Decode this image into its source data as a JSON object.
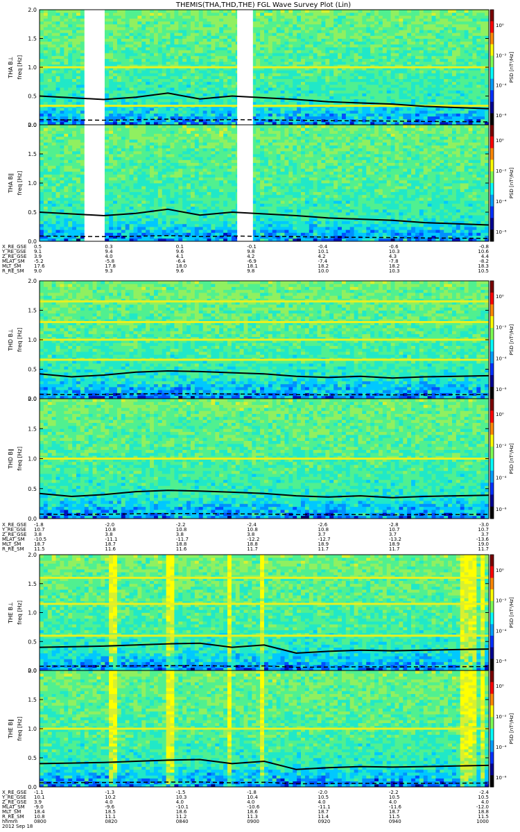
{
  "title": "THEMIS(THA,THD,THE) FGL Wave Survey Plot (Lin)",
  "colorbar": {
    "label": "PSD [nT²/Hz]",
    "ticks": [
      "10⁰",
      "10⁻²",
      "10⁻⁴",
      "10⁻⁶"
    ],
    "colors": [
      "#7a0000",
      "#ff0000",
      "#ff8800",
      "#ffff00",
      "#7fff55",
      "#00ffff",
      "#00a0ff",
      "#0030ff",
      "#000090",
      "#000000"
    ]
  },
  "chart_data": [
    {
      "type": "heatmap",
      "probe": "THA",
      "panel_label": "THA B⊥",
      "ylabel": "freq [Hz]",
      "ylim": [
        0,
        2.0
      ],
      "yticks": [
        "0.0",
        "0.5",
        "1.0",
        "1.5",
        "2.0"
      ],
      "data_gaps_fraction": [
        [
          0.1,
          0.145
        ],
        [
          0.44,
          0.475
        ]
      ],
      "harmonic_lines_hz": [
        1.0,
        0.33
      ],
      "gyro_curve_hz": [
        0.5,
        0.47,
        0.44,
        0.48,
        0.55,
        0.45,
        0.5,
        0.47,
        0.44,
        0.4,
        0.38,
        0.36,
        0.32,
        0.3,
        0.28
      ]
    },
    {
      "type": "heatmap",
      "probe": "THA",
      "panel_label": "THA B∥",
      "ylabel": "freq [Hz]",
      "ylim": [
        0,
        2.0
      ],
      "yticks": [
        "0.0",
        "0.5",
        "1.0",
        "1.5",
        "2.0"
      ],
      "data_gaps_fraction": [
        [
          0.1,
          0.145
        ],
        [
          0.44,
          0.475
        ]
      ],
      "harmonic_lines_hz": [],
      "gyro_curve_hz": [
        0.5,
        0.47,
        0.44,
        0.48,
        0.55,
        0.45,
        0.5,
        0.47,
        0.44,
        0.4,
        0.38,
        0.36,
        0.32,
        0.3,
        0.28
      ]
    },
    {
      "type": "heatmap",
      "probe": "THD",
      "panel_label": "THD B⊥",
      "ylabel": "freq [Hz]",
      "ylim": [
        0,
        2.0
      ],
      "yticks": [
        "0.0",
        "0.5",
        "1.0",
        "1.5",
        "2.0"
      ],
      "data_gaps_fraction": [],
      "harmonic_lines_hz": [
        1.65,
        1.3,
        1.0,
        0.66
      ],
      "gyro_curve_hz": [
        0.42,
        0.37,
        0.4,
        0.45,
        0.47,
        0.46,
        0.44,
        0.42,
        0.38,
        0.36,
        0.38,
        0.35,
        0.37,
        0.38,
        0.39
      ]
    },
    {
      "type": "heatmap",
      "probe": "THD",
      "panel_label": "THD B∥",
      "ylabel": "freq [Hz]",
      "ylim": [
        0,
        2.0
      ],
      "yticks": [
        "0.0",
        "0.5",
        "1.0",
        "1.5",
        "2.0"
      ],
      "data_gaps_fraction": [],
      "harmonic_lines_hz": [
        1.0
      ],
      "gyro_curve_hz": [
        0.42,
        0.37,
        0.4,
        0.45,
        0.47,
        0.46,
        0.44,
        0.42,
        0.38,
        0.36,
        0.38,
        0.35,
        0.37,
        0.38,
        0.39
      ]
    },
    {
      "type": "heatmap",
      "probe": "THE",
      "panel_label": "THE B⊥",
      "ylabel": "freq [Hz]",
      "ylim": [
        0,
        2.0
      ],
      "yticks": [
        "0.0",
        "0.5",
        "1.0",
        "1.5",
        "2.0"
      ],
      "data_gaps_fraction": [],
      "harmonic_lines_hz": [
        1.6,
        1.15,
        0.6
      ],
      "vertical_bands_fraction": [
        0.16,
        0.285,
        0.42,
        0.49,
        0.94,
        0.96,
        0.98
      ],
      "gyro_curve_hz": [
        0.4,
        0.41,
        0.42,
        0.44,
        0.46,
        0.47,
        0.4,
        0.44,
        0.3,
        0.33,
        0.35,
        0.34,
        0.35,
        0.36,
        0.37
      ]
    },
    {
      "type": "heatmap",
      "probe": "THE",
      "panel_label": "THE B∥",
      "ylabel": "freq [Hz]",
      "ylim": [
        0,
        2.0
      ],
      "yticks": [
        "0.0",
        "0.5",
        "1.0",
        "1.5",
        "2.0"
      ],
      "data_gaps_fraction": [],
      "harmonic_lines_hz": [
        1.0
      ],
      "vertical_bands_fraction": [
        0.16,
        0.285,
        0.42,
        0.49,
        0.94,
        0.96,
        0.98
      ],
      "gyro_curve_hz": [
        0.4,
        0.41,
        0.42,
        0.44,
        0.46,
        0.47,
        0.4,
        0.44,
        0.3,
        0.33,
        0.35,
        0.34,
        0.35,
        0.36,
        0.37
      ]
    }
  ],
  "ephemeris": [
    {
      "labels": [
        "X_RE_GSE",
        "Y_RE_GSE",
        "Z_RE_GSE",
        "MLAT_SM",
        "MLT_SM",
        "R_RE_SM"
      ],
      "columns": [
        [
          "0.5",
          "9.1",
          "3.9",
          "-5.2",
          "17.6",
          "9.0"
        ],
        [
          "0.3",
          "9.4",
          "4.0",
          "-5.8",
          "17.8",
          "9.3"
        ],
        [
          "0.1",
          "9.6",
          "4.1",
          "-6.4",
          "18.0",
          "9.6"
        ],
        [
          "-0.1",
          "9.8",
          "4.2",
          "-6.9",
          "18.1",
          "9.8"
        ],
        [
          "-0.4",
          "10.1",
          "4.2",
          "-7.4",
          "18.2",
          "10.0"
        ],
        [
          "-0.6",
          "10.3",
          "4.3",
          "-7.8",
          "18.2",
          "10.3"
        ],
        [
          "-0.8",
          "10.6",
          "4.4",
          "-8.2",
          "18.3",
          "10.5"
        ]
      ]
    },
    {
      "labels": [
        "X_RE_GSE",
        "Y_RE_GSE",
        "Z_RE_GSE",
        "MLAT_SM",
        "MLT_SM",
        "R_RE_SM"
      ],
      "columns": [
        [
          "-1.8",
          "10.7",
          "3.8",
          "-10.5",
          "18.7",
          "11.5"
        ],
        [
          "-2.0",
          "10.8",
          "3.8",
          "-11.1",
          "18.7",
          "11.6"
        ],
        [
          "-2.2",
          "10.8",
          "3.8",
          "-11.7",
          "18.8",
          "11.6"
        ],
        [
          "-2.4",
          "10.8",
          "3.8",
          "-12.2",
          "18.8",
          "11.7"
        ],
        [
          "-2.6",
          "10.8",
          "3.7",
          "-12.7",
          "18.9",
          "11.7"
        ],
        [
          "-2.8",
          "10.7",
          "3.7",
          "-13.2",
          "18.9",
          "11.7"
        ],
        [
          "-3.0",
          "10.7",
          "3.7",
          "-13.6",
          "19.0",
          "11.7"
        ]
      ]
    },
    {
      "labels": [
        "X_RE_GSE",
        "Y_RE_GSE",
        "Z_RE_GSE",
        "MLAT_SM",
        "MLT_SM",
        "R_RE_SM",
        "hhmm",
        "2012 Sep 18"
      ],
      "columns": [
        [
          "-1.1",
          "10.1",
          "3.9",
          "-9.0",
          "18.4",
          "10.8",
          "0800"
        ],
        [
          "-1.3",
          "10.2",
          "4.0",
          "-9.6",
          "18.5",
          "11.1",
          "0820"
        ],
        [
          "-1.5",
          "10.3",
          "4.0",
          "-10.1",
          "18.6",
          "11.2",
          "0840"
        ],
        [
          "-1.8",
          "10.4",
          "4.0",
          "-10.6",
          "18.6",
          "11.3",
          "0900"
        ],
        [
          "-2.0",
          "10.5",
          "4.0",
          "-11.1",
          "18.7",
          "11.4",
          "0920"
        ],
        [
          "-2.2",
          "10.5",
          "4.0",
          "-11.6",
          "18.7",
          "11.5",
          "0940"
        ],
        [
          "-2.4",
          "10.5",
          "4.0",
          "-12.0",
          "18.8",
          "11.5",
          "1000"
        ]
      ]
    }
  ]
}
